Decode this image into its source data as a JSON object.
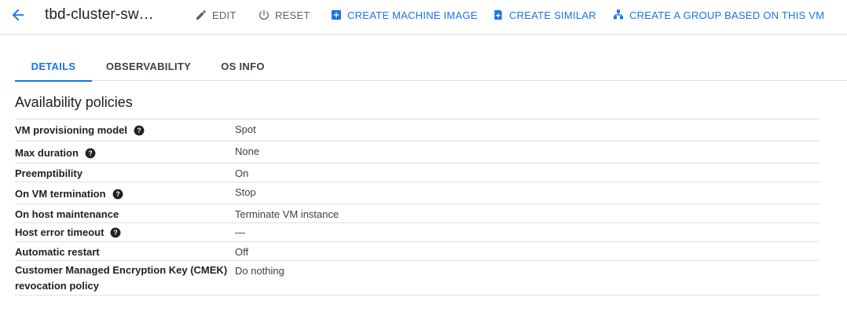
{
  "header": {
    "title": "tbd-cluster-sw…",
    "actions": [
      {
        "label": "EDIT",
        "icon": "pencil-icon"
      },
      {
        "label": "RESET",
        "icon": "power-icon"
      },
      {
        "label": "CREATE MACHINE IMAGE",
        "icon": "add-box-icon"
      },
      {
        "label": "CREATE SIMILAR",
        "icon": "add-copy-icon"
      },
      {
        "label": "CREATE A GROUP BASED ON THIS VM",
        "icon": "group-icon"
      }
    ]
  },
  "tabs": [
    {
      "label": "DETAILS",
      "active": true
    },
    {
      "label": "OBSERVABILITY",
      "active": false
    },
    {
      "label": "OS INFO",
      "active": false
    }
  ],
  "section": {
    "title": "Availability policies",
    "rows": [
      {
        "key": "VM provisioning model",
        "value": "Spot",
        "help": true
      },
      {
        "key": "Max duration",
        "value": "None",
        "help": true
      },
      {
        "key": "Preemptibility",
        "value": "On",
        "help": false
      },
      {
        "key": "On VM termination",
        "value": "Stop",
        "help": true
      },
      {
        "key": "On host maintenance",
        "value": "Terminate VM instance",
        "help": false
      },
      {
        "key": "Host error timeout",
        "value": "—",
        "help": true
      },
      {
        "key": "Automatic restart",
        "value": "Off",
        "help": false
      },
      {
        "key_line1": "Customer Managed Encryption Key (CMEK)",
        "key_line2": "revocation policy",
        "value": "Do nothing",
        "help": false
      }
    ]
  },
  "colors": {
    "accent": "#1a73e8",
    "text": "#202124",
    "muted": "#5f6368",
    "divider": "#dadce0"
  }
}
